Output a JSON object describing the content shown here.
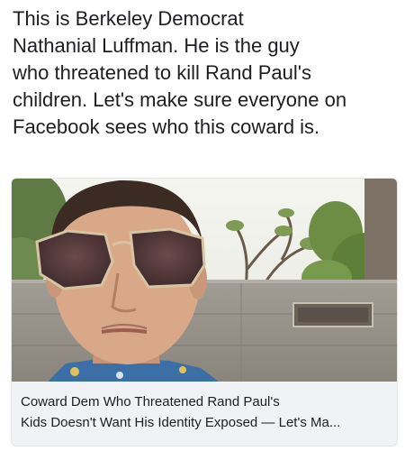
{
  "post": {
    "text_lines": [
      "This is Berkeley Democrat",
      "Nathanial Luffman. He is the guy",
      "who threatened to kill Rand Paul's",
      "children. Let's make sure everyone on",
      "Facebook sees who this coward is."
    ]
  },
  "link_card": {
    "image_icon": "photo-icon",
    "caption_lines": [
      "Coward Dem Who Threatened Rand Paul's",
      "Kids Doesn't Want His Identity Exposed — Let's Ma..."
    ]
  },
  "colors": {
    "text": "#1c1e21",
    "card_background": "#f0f2f5",
    "card_border": "#e4e6eb"
  }
}
